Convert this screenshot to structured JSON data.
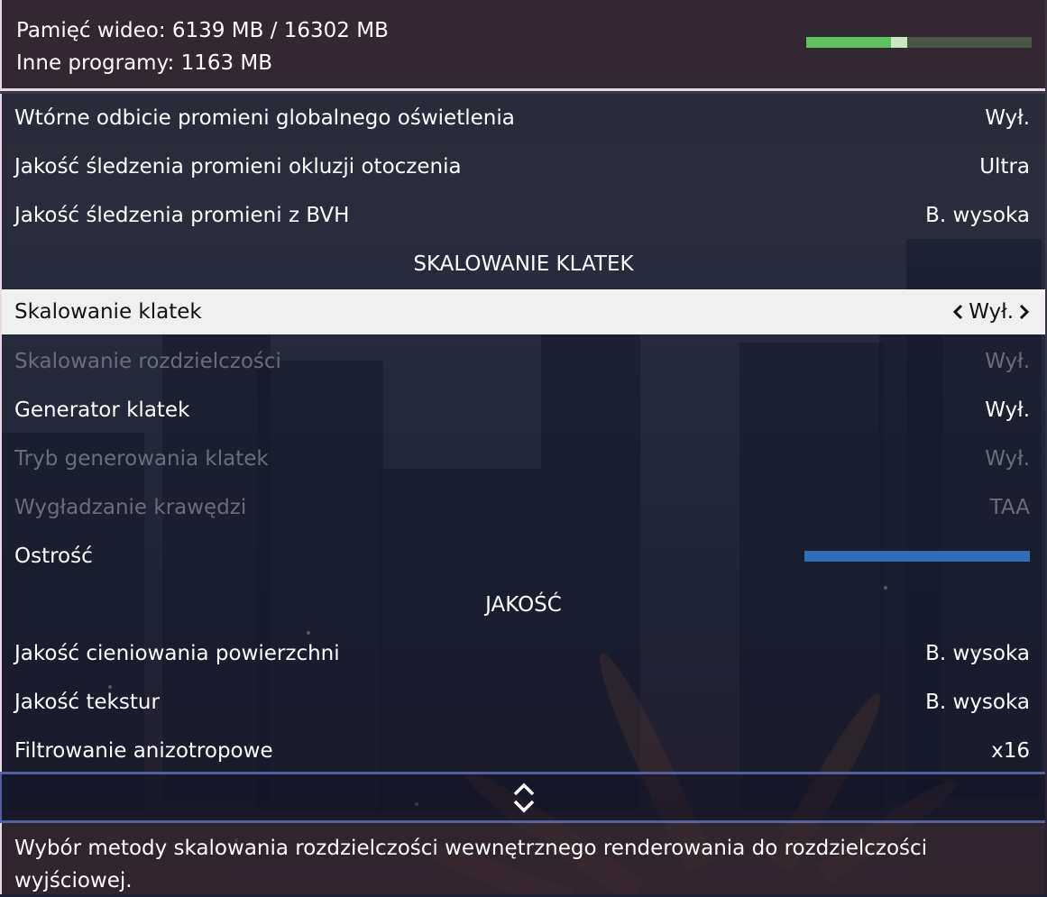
{
  "memory": {
    "video_label": "Pamięć wideo: 6139 MB / 16302 MB",
    "other_label": "Inne programy: 1163 MB",
    "bar": {
      "used_fraction": 0.377,
      "other_fraction": 0.071,
      "used_color": "#5fbf63",
      "other_color": "#c8e8c4"
    }
  },
  "settings": [
    {
      "label": "Wtórne odbicie promieni globalnego oświetlenia",
      "value": "Wył."
    },
    {
      "label": "Jakość śledzenia promieni okluzji otoczenia",
      "value": "Ultra"
    },
    {
      "label": "Jakość śledzenia promieni z BVH",
      "value": "B. wysoka"
    }
  ],
  "section_upscaling": "SKALOWANIE KLATEK",
  "upscaling": [
    {
      "label": "Skalowanie klatek",
      "value": "Wył.",
      "state": "selected"
    },
    {
      "label": "Skalowanie rozdzielczości",
      "value": "Wył.",
      "state": "disabled"
    },
    {
      "label": "Generator klatek",
      "value": "Wył.",
      "state": "normal"
    },
    {
      "label": "Tryb generowania klatek",
      "value": "Wył.",
      "state": "disabled"
    },
    {
      "label": "Wygładzanie krawędzi",
      "value": "TAA",
      "state": "disabled"
    },
    {
      "label": "Ostrość",
      "slider_fraction": 1.0,
      "slider_color": "#2f6db6",
      "state": "normal"
    }
  ],
  "section_quality": "JAKOŚĆ",
  "quality": [
    {
      "label": "Jakość cieniowania powierzchni",
      "value": "B. wysoka"
    },
    {
      "label": "Jakość tekstur",
      "value": "B. wysoka"
    },
    {
      "label": "Filtrowanie anizotropowe",
      "value": "x16"
    }
  ],
  "icons": {
    "prev": "chevron-left-icon",
    "next": "chevron-right-icon",
    "scroll": "scroll-up-down-icon"
  },
  "description": "Wybór metody skalowania rozdzielczości wewnętrznego renderowania do rozdzielczości wyjściowej."
}
